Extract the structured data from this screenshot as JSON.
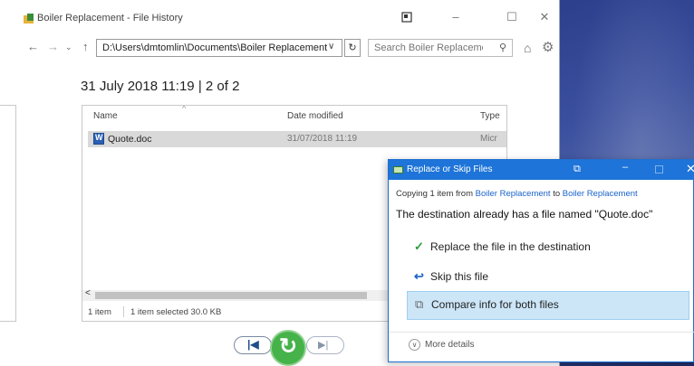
{
  "window": {
    "title": "Boiler Replacement - File History"
  },
  "address_bar": {
    "path": "D:\\Users\\dmtomlin\\Documents\\Boiler Replacement"
  },
  "search": {
    "placeholder": "Search Boiler Replacement"
  },
  "snapshot": {
    "title": "31 July 2018 11:19  |  2 of 2"
  },
  "columns": {
    "name": "Name",
    "date_modified": "Date modified",
    "type": "Type"
  },
  "files": [
    {
      "name": "Quote.doc",
      "date_modified": "31/07/2018 11:19",
      "type": "Micr"
    }
  ],
  "status_bar": {
    "item_count": "1 item",
    "selection": "1 item selected  30.0 KB"
  },
  "dialog": {
    "title": "Replace or Skip Files",
    "copying_prefix": "Copying 1 item from ",
    "source": "Boiler Replacement",
    "copying_to": " to ",
    "destination": "Boiler Replacement",
    "message": "The destination already has a file named \"Quote.doc\"",
    "options": [
      {
        "label": "Replace the file in the destination",
        "icon": "checkmark-icon"
      },
      {
        "label": "Skip this file",
        "icon": "skip-arrow-icon"
      },
      {
        "label": "Compare info for both files",
        "icon": "compare-icon"
      }
    ],
    "more_details": "More details"
  },
  "colors": {
    "dialog_title_bar": "#1e74d8",
    "restore_button": "#45b24a",
    "selected_option": "#cce6f8",
    "link": "#1a63c9"
  }
}
